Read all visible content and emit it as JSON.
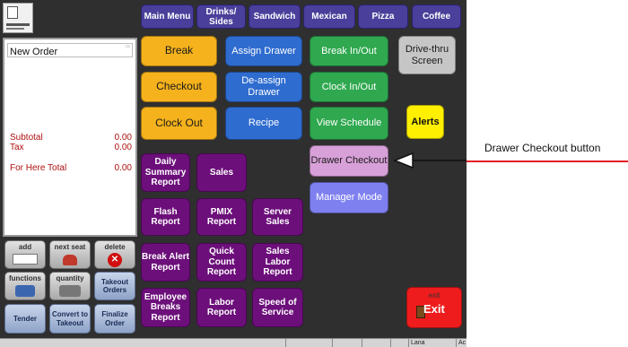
{
  "categories": [
    "Main Menu",
    "Drinks/ Sides",
    "Sandwich",
    "Mexican",
    "Pizza",
    "Coffee"
  ],
  "order": {
    "title": "New Order",
    "subtotal_label": "Subtotal",
    "subtotal_value": "0.00",
    "tax_label": "Tax",
    "tax_value": "0.00",
    "total_label": "For Here Total",
    "total_value": "0.00"
  },
  "left_buttons": {
    "add": "add",
    "next_seat": "next seat",
    "delete": "delete",
    "functions": "functions",
    "quantity": "quantity",
    "takeout_orders": "Takeout Orders",
    "tender": "Tender",
    "convert_to_takeout": "Convert to Takeout",
    "finalize_order": "Finalize Order"
  },
  "buttons": {
    "break": "Break",
    "assign_drawer": "Assign Drawer",
    "break_in_out": "Break In/Out",
    "drive_thru_screen": "Drive-thru Screen",
    "checkout": "Checkout",
    "deassign_drawer": "De-assign Drawer",
    "clock_in_out": "Clock In/Out",
    "clock_out": "Clock Out",
    "recipe": "Recipe",
    "view_schedule": "View Schedule",
    "alerts": "Alerts",
    "drawer_checkout": "Drawer Checkout",
    "manager_mode": "Manager Mode",
    "exit_small": "exit",
    "exit": "Exit"
  },
  "reports": {
    "daily_summary": "Daily Summary Report",
    "sales": "Sales",
    "flash": "Flash Report",
    "pmix": "PMIX Report",
    "server_sales": "Server Sales",
    "break_alert": "Break Alert Report",
    "quick_count": "Quick Count Report",
    "sales_labor": "Sales Labor Report",
    "employee_breaks": "Employee Breaks Report",
    "labor": "Labor Report",
    "speed_of_service": "Speed of Service"
  },
  "status_bar": {
    "user": "Lana",
    "extra": "Ac"
  },
  "annotation": {
    "label": "Drawer Checkout button"
  },
  "colors": {
    "background": "#2f2f2f",
    "tab": "#4a3f9a",
    "orange": "#f5b21c",
    "blue": "#2f6ccf",
    "green": "#2fa84f",
    "purple": "#6c0f7a",
    "pink": "#d8a0d8",
    "lavender": "#7f80f0",
    "yellow": "#ffef00",
    "red": "#ee1c1c",
    "annotation_line": "#e31e24"
  }
}
